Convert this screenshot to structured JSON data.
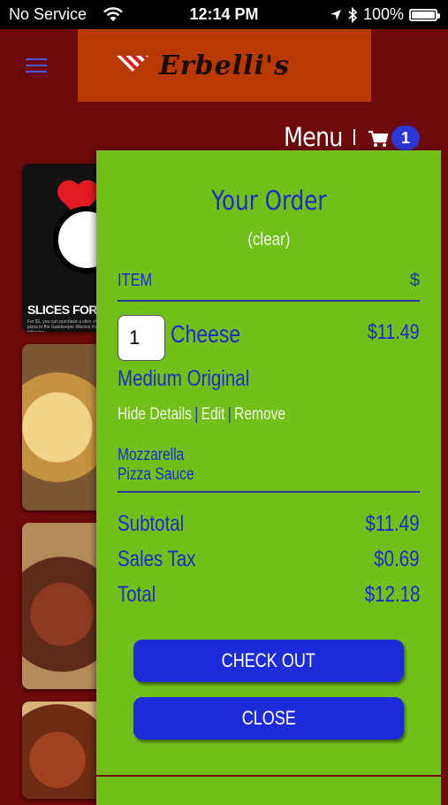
{
  "status_bar": {
    "carrier": "No Service",
    "time": "12:14 PM",
    "battery": "100%"
  },
  "header": {
    "logo_text": "Erbelli's",
    "menu_label": "Menu",
    "cart_count": "1"
  },
  "background_cards": {
    "card1_text": "SLICES FOR",
    "card1_subtext": "For $1, you can purchase a slice of pizza to the Gatekeeper Mission the following"
  },
  "order": {
    "title": "Your Order",
    "clear_label": "(clear)",
    "columns": {
      "item": "ITEM",
      "price": "$"
    },
    "item": {
      "quantity": "1",
      "name": "Cheese",
      "price": "$11.49",
      "size": "Medium Original",
      "actions": {
        "hide_details": "Hide Details",
        "edit": "Edit",
        "remove": "Remove"
      },
      "toppings": [
        "Mozzarella",
        "Pizza Sauce"
      ]
    },
    "summary": {
      "subtotal_label": "Subtotal",
      "subtotal": "$11.49",
      "tax_label": "Sales Tax",
      "tax": "$0.69",
      "total_label": "Total",
      "total": "$12.18"
    },
    "buttons": {
      "checkout": "CHECK OUT",
      "close": "CLOSE"
    }
  },
  "colors": {
    "page_bg": "#6e0a0a",
    "panel_bg": "#73bf1a",
    "accent_blue": "#1e2bc8",
    "button_blue": "#1e2bd8",
    "logo_bg": "#b83a00",
    "badge_bg": "#2b35d8"
  },
  "icons": [
    "wifi-icon",
    "location-arrow-icon",
    "bluetooth-icon",
    "battery-icon",
    "hamburger-menu-icon",
    "cart-icon"
  ]
}
